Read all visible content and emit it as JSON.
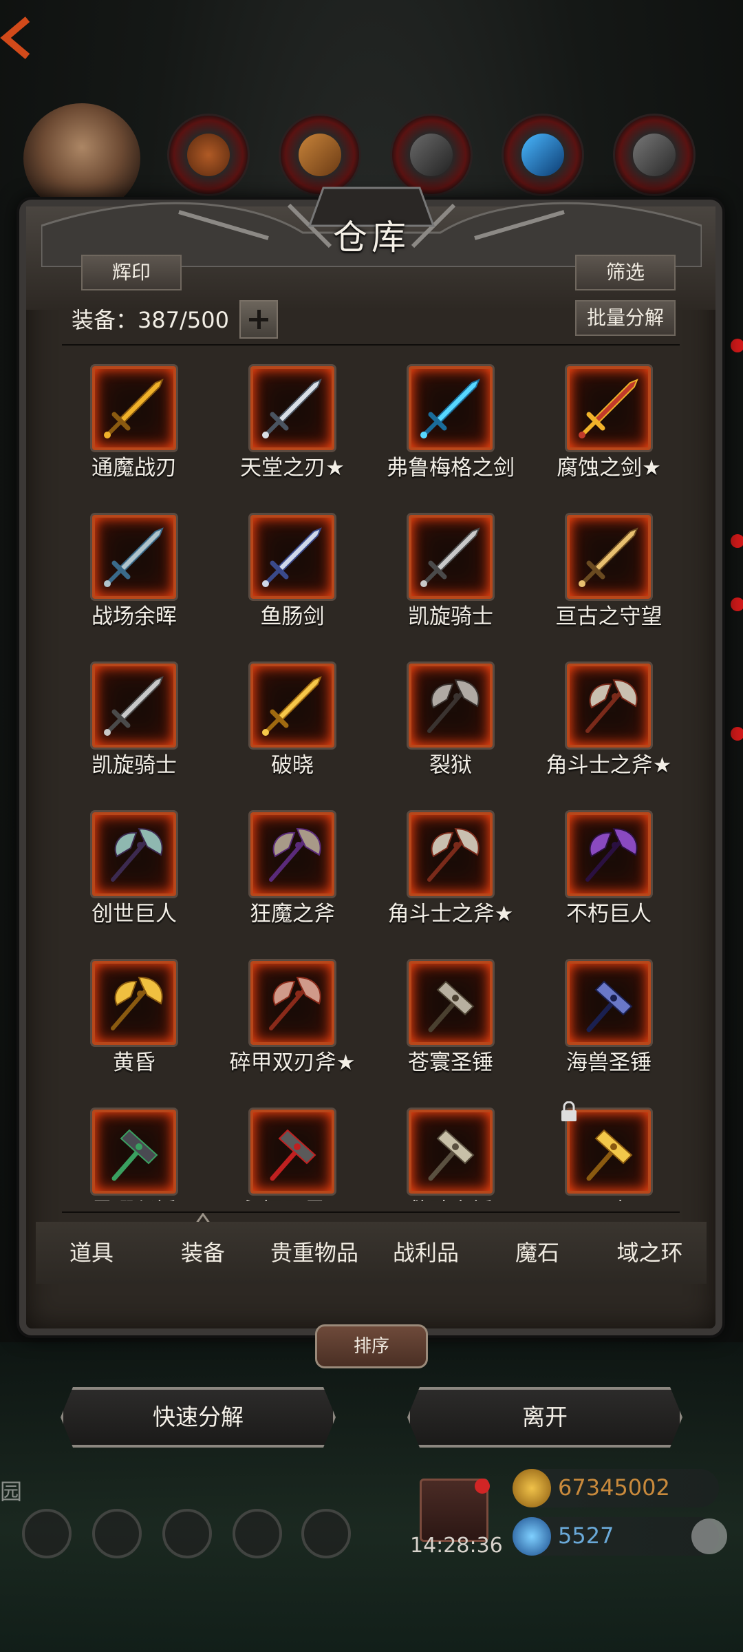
{
  "title": "仓库",
  "buttons": {
    "emblem": "辉印",
    "filter": "筛选",
    "batch_decompose": "批量分解",
    "sort": "排序",
    "quick_decompose": "快速分解",
    "leave": "离开"
  },
  "equipment_count": "装备：387/500",
  "items": [
    {
      "name": "通魔战刃",
      "icon": "golden-spear-icon"
    },
    {
      "name": "天堂之刃★",
      "icon": "silver-sword-icon"
    },
    {
      "name": "弗鲁梅格之剑",
      "icon": "ice-blue-sword-icon"
    },
    {
      "name": "腐蚀之剑★",
      "icon": "corroded-red-sword-icon"
    },
    {
      "name": "战场余晖",
      "icon": "ornate-steel-sword-icon"
    },
    {
      "name": "鱼肠剑",
      "icon": "slim-blue-sword-icon"
    },
    {
      "name": "凯旋骑士",
      "icon": "greatsword-icon"
    },
    {
      "name": "亘古之守望",
      "icon": "golden-sword-icon"
    },
    {
      "name": "凯旋骑士",
      "icon": "greatsword-icon"
    },
    {
      "name": "破晓",
      "icon": "dawn-gold-sword-icon"
    },
    {
      "name": "裂狱",
      "icon": "dark-axe-icon"
    },
    {
      "name": "角斗士之斧★",
      "icon": "gladiator-axe-icon"
    },
    {
      "name": "创世巨人",
      "icon": "giant-battleaxe-icon"
    },
    {
      "name": "狂魔之斧",
      "icon": "demon-axe-icon"
    },
    {
      "name": "角斗士之斧★",
      "icon": "gladiator-axe-icon"
    },
    {
      "name": "不朽巨人",
      "icon": "purple-axe-icon"
    },
    {
      "name": "黄昏",
      "icon": "golden-axe-icon"
    },
    {
      "name": "碎甲双刃斧★",
      "icon": "double-blade-axe-icon"
    },
    {
      "name": "苍寰圣锤",
      "icon": "holy-mace-icon"
    },
    {
      "name": "海兽圣锤",
      "icon": "sea-beast-hammer-icon"
    },
    {
      "name": "黑曜坚锤",
      "icon": "obsidian-hammer-icon"
    },
    {
      "name": "永恒风暴★",
      "icon": "storm-hammer-icon"
    },
    {
      "name": "救赎之锤",
      "icon": "redemption-hammer-icon"
    },
    {
      "name": "圣庭",
      "icon": "golden-hammer-icon",
      "locked": true
    }
  ],
  "tabs": [
    "道具",
    "装备",
    "贵重物品",
    "战利品",
    "魔石",
    "域之环"
  ],
  "active_tab": "装备",
  "hud": {
    "timer": "14:28:36",
    "gold": "67345002",
    "gems": "5527",
    "side_label": "园"
  },
  "colors": {
    "slot_border": "#b8471a",
    "slot_glow": "#ff4a12",
    "gold_text": "#c98a3c",
    "gem_text": "#6aa9d8"
  }
}
